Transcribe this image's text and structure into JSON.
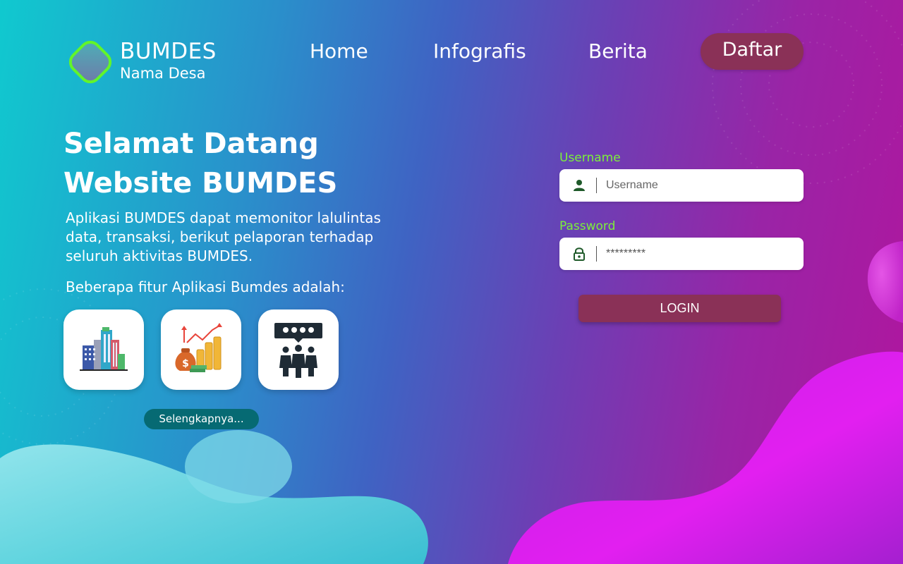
{
  "brand": {
    "title": "BUMDES",
    "subtitle": "Nama Desa"
  },
  "nav": {
    "home": "Home",
    "infografis": "Infografis",
    "berita": "Berita",
    "daftar": "Daftar"
  },
  "hero": {
    "title_line1": "Selamat Datang",
    "title_line2": "Website BUMDES",
    "description": "Aplikasi BUMDES dapat memonitor lalulintas data, transaksi, berikut pelaporan terhadap seluruh aktivitas BUMDES.",
    "features_intro": "Beberapa fitur Aplikasi Bumdes adalah:",
    "features": [
      {
        "icon": "buildings-icon"
      },
      {
        "icon": "money-growth-icon"
      },
      {
        "icon": "community-icon"
      }
    ],
    "more_button": "Selengkapnya..."
  },
  "login": {
    "username_label": "Username",
    "username_placeholder": "Username",
    "password_label": "Password",
    "password_value": "*********",
    "button": "LOGIN"
  },
  "colors": {
    "accent_green": "#7cf03a",
    "button_maroon": "#8a3157",
    "button_teal": "#066a73"
  }
}
